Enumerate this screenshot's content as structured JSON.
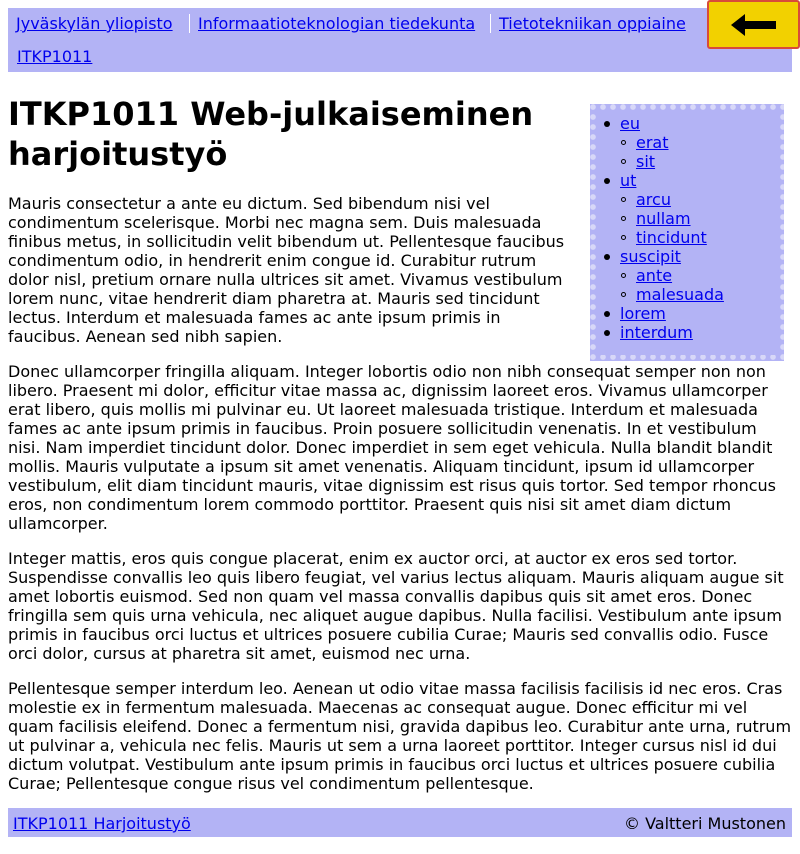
{
  "header": {
    "breadcrumbs": [
      "Jyväskylän yliopisto",
      "Informaatioteknologian tiedekunta",
      "Tietotekniikan oppiaine",
      "ITKP1011"
    ],
    "back_icon": "back-arrow-icon",
    "colors": {
      "band": "#b3b3f5",
      "button_fill": "#f2d100",
      "button_border": "#d84b3a"
    }
  },
  "main": {
    "title": "ITKP1011 Web-julkaiseminen harjoitustyö",
    "paragraphs": [
      "Mauris consectetur a ante eu dictum. Sed bibendum nisi vel condimentum scelerisque. Morbi nec magna sem. Duis malesuada finibus metus, in sollicitudin velit bibendum ut. Pellentesque faucibus condimentum odio, in hendrerit enim congue id. Curabitur rutrum dolor nisl, pretium ornare nulla ultrices sit amet. Vivamus vestibulum lorem nunc, vitae hendrerit diam pharetra at. Mauris sed tincidunt lectus. Interdum et malesuada fames ac ante ipsum primis in faucibus. Aenean sed nibh sapien.",
      "Donec ullamcorper fringilla aliquam. Integer lobortis odio non nibh consequat semper non non libero. Praesent mi dolor, efficitur vitae massa ac, dignissim laoreet eros. Vivamus ullamcorper erat libero, quis mollis mi pulvinar eu. Ut laoreet malesuada tristique. Interdum et malesuada fames ac ante ipsum primis in faucibus. Proin posuere sollicitudin venenatis. In et vestibulum nisi. Nam imperdiet tincidunt dolor. Donec imperdiet in sem eget vehicula. Nulla blandit blandit mollis. Mauris vulputate a ipsum sit amet venenatis. Aliquam tincidunt, ipsum id ullamcorper vestibulum, elit diam tincidunt mauris, vitae dignissim est risus quis tortor. Sed tempor rhoncus eros, non condimentum lorem commodo porttitor. Praesent quis nisi sit amet diam dictum ullamcorper.",
      "Integer mattis, eros quis congue placerat, enim ex auctor orci, at auctor ex eros sed tortor. Suspendisse convallis leo quis libero feugiat, vel varius lectus aliquam. Mauris aliquam augue sit amet lobortis euismod. Sed non quam vel massa convallis dapibus quis sit amet eros. Donec fringilla sem quis urna vehicula, nec aliquet augue dapibus. Nulla facilisi. Vestibulum ante ipsum primis in faucibus orci luctus et ultrices posuere cubilia Curae; Mauris sed convallis odio. Fusce orci dolor, cursus at pharetra sit amet, euismod nec urna.",
      "Pellentesque semper interdum leo. Aenean ut odio vitae massa facilisis facilisis id nec eros. Cras molestie ex in fermentum malesuada. Maecenas ac consequat augue. Donec efficitur mi vel quam facilisis eleifend. Donec a fermentum nisi, gravida dapibus leo. Curabitur ante urna, rutrum ut pulvinar a, vehicula nec felis. Mauris ut sem a urna laoreet porttitor. Integer cursus nisl id dui dictum volutpat. Vestibulum ante ipsum primis in faucibus orci luctus et ultrices posuere cubilia Curae; Pellentesque congue risus vel condimentum pellentesque."
    ]
  },
  "sidenav": {
    "items": [
      {
        "label": "eu",
        "level": 1
      },
      {
        "label": "erat",
        "level": 2
      },
      {
        "label": "sit",
        "level": 2
      },
      {
        "label": "ut",
        "level": 1
      },
      {
        "label": "arcu",
        "level": 2
      },
      {
        "label": "nullam",
        "level": 2
      },
      {
        "label": "tincidunt",
        "level": 2
      },
      {
        "label": "suscipit",
        "level": 1
      },
      {
        "label": "ante",
        "level": 2
      },
      {
        "label": "malesuada",
        "level": 2
      },
      {
        "label": "lorem",
        "level": 1
      },
      {
        "label": "interdum",
        "level": 1
      }
    ]
  },
  "footer": {
    "link": "ITKP1011 Harjoitustyö",
    "copyright": "© Valtteri Mustonen"
  }
}
